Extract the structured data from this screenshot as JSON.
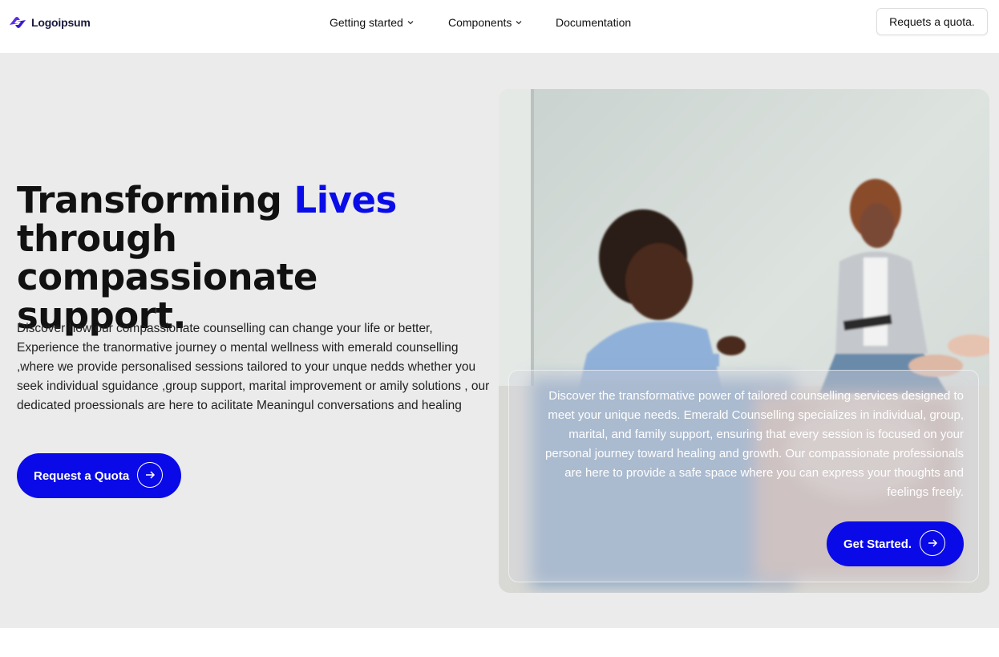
{
  "nav": {
    "logo_text": "Logoipsum",
    "menu": [
      {
        "label": "Getting started",
        "has_dropdown": true
      },
      {
        "label": "Components",
        "has_dropdown": true
      },
      {
        "label": "Documentation",
        "has_dropdown": false
      }
    ],
    "quota_button": "Requets a quota."
  },
  "hero": {
    "headline_part1": "Transforming ",
    "headline_accent": "Lives",
    "headline_part2": "through compassionate support.",
    "description": "Discover how our compassionate counselling can change your life or better, Experience the tranormative journey o mental wellness with emerald counselling ,where we provide personalised sessions tailored to your unque nedds whether you seek individual sguidance ,group support, marital improvement or amily solutions , our dedicated proessionals are here to acilitate Meaningul conversations and healing",
    "cta_label": "Request a Quota"
  },
  "card": {
    "text": "Discover the transformative power of tailored counselling services designed to meet your unique needs. Emerald Counselling specializes in individual, group, marital, and family support, ensuring that every session is focused on your personal journey toward healing and growth. Our compassionate professionals are here to provide a safe space where you can express your thoughts and feelings freely.",
    "button_label": "Get Started."
  },
  "colors": {
    "accent": "#0a0ce8",
    "hero_background": "#ebebeb",
    "text": "#111111"
  },
  "icons": {
    "logo": "logo-mark-icon",
    "dropdown": "chevron-down-icon",
    "cta": "arrow-right-circle-icon"
  }
}
